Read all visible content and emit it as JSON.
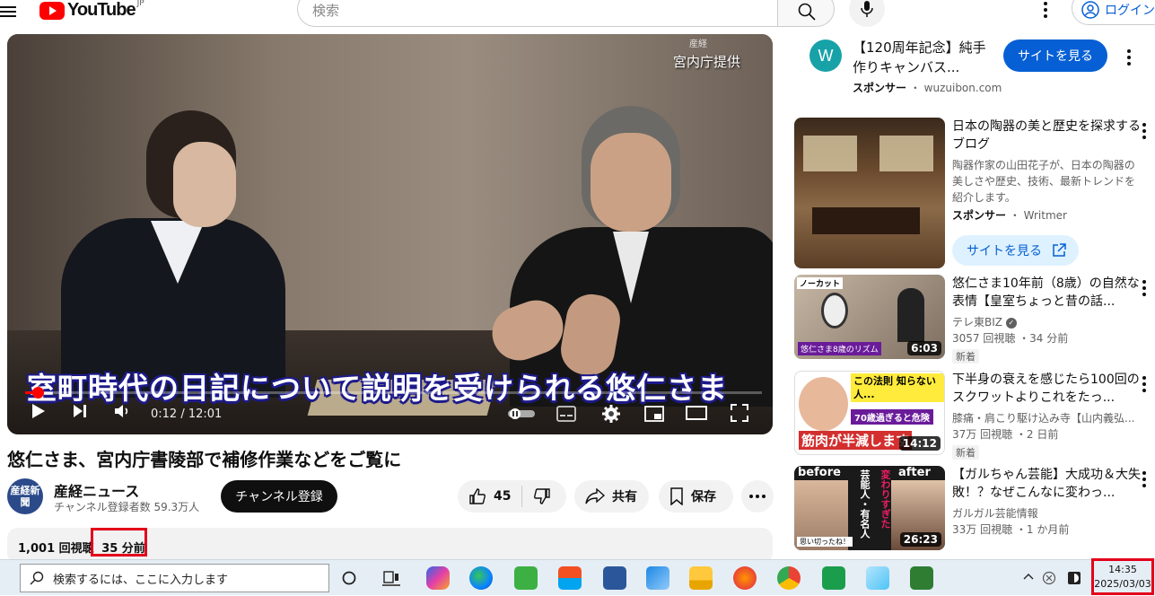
{
  "header": {
    "logo_text": "YouTube",
    "logo_region": "JP",
    "search_placeholder": "検索",
    "login_label": "ログイン"
  },
  "player": {
    "credit": "宮内庁提供",
    "watermark": "産経",
    "subtitle": "室町時代の日記について説明を受けられる悠仁さま",
    "time_current": "0:12",
    "time_total": "12:01",
    "progress_fraction": 0.017
  },
  "video": {
    "title": "悠仁さま、宮内庁書陵部で補修作業などをご覧に",
    "channel_name": "産経ニュース",
    "channel_avatar_text": "産経新聞",
    "channel_subs": "チャンネル登録者数 59.3万人",
    "subscribe_label": "チャンネル登録",
    "like_count": "45",
    "share_label": "共有",
    "save_label": "保存",
    "views": "1,001 回視聴",
    "ago": "35 分前"
  },
  "sidebar": {
    "ad1": {
      "avatar_letter": "W",
      "title": "【120周年記念】純手作りキャンバス...",
      "sponsor_label": "スポンサー",
      "domain": "wuzuibon.com",
      "visit_label": "サイトを見る"
    },
    "ad2": {
      "title": "日本の陶器の美と歴史を探求するブログ",
      "desc": "陶器作家の山田花子が、日本の陶器の美しさや歴史、技術、最新トレンドを紹介します。",
      "sponsor_label": "スポンサー",
      "advertiser": "Writmer",
      "visit_label": "サイトを見る"
    },
    "recs": [
      {
        "title": "悠仁さま10年前（8歳）の自然な表情【皇室ちょっと昔の話...",
        "channel": "テレ東BIZ",
        "stats": "3057 回視聴 ・34 分前",
        "badge": "新着",
        "duration": "6:03",
        "thumb_text_top": "ノーカット",
        "thumb_text_bottom": "悠仁さま8歳のリズム"
      },
      {
        "title": "下半身の衰えを感じたら100回のスクワットよりこれをたっ...",
        "channel": "膝痛・肩こり駆け込み寺【山内義弘...",
        "stats": "37万 回視聴 ・2 日前",
        "badge": "新着",
        "duration": "14:12",
        "thumb_text_top": "この法則 知らない人...",
        "thumb_text_mid": "70歳過ぎると危険",
        "thumb_text_bottom": "筋肉が半減します"
      },
      {
        "title": "【ガルちゃん芸能】大成功＆大失敗！？なぜこんなに変わっ...",
        "channel": "ガルガル芸能情報",
        "stats": "33万 回視聴 ・1 か月前",
        "duration": "26:23",
        "thumb_text_before": "before",
        "thumb_text_after": "after",
        "thumb_text_mid": "芸能人・有名人",
        "thumb_text_side": "変わりすぎた",
        "thumb_text_caption": "思い切ったね！"
      }
    ]
  },
  "taskbar": {
    "search_placeholder": "検索するには、ここに入力します",
    "time": "14:35",
    "date": "2025/03/03"
  },
  "colors": {
    "brand_red": "#ff0000",
    "link_blue": "#065fd4",
    "highlight_red": "#e3001b"
  }
}
